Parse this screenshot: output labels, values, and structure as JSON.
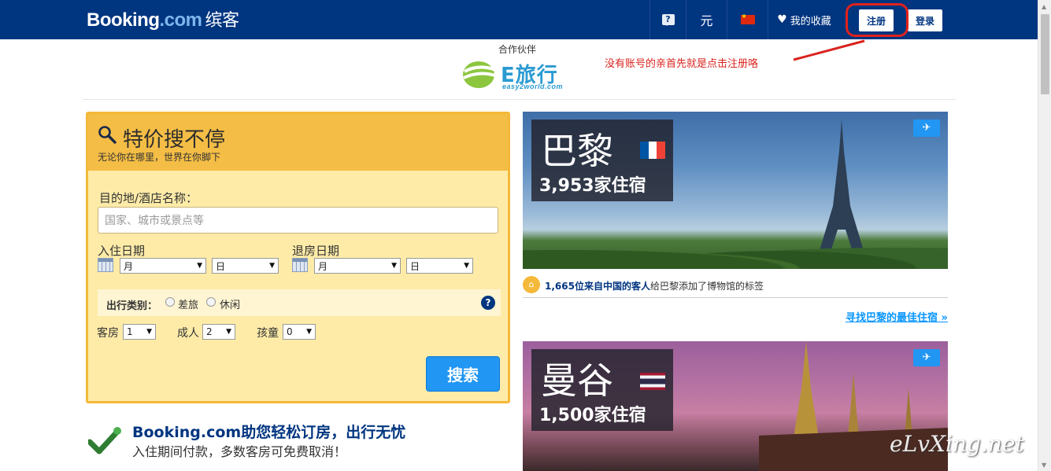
{
  "header": {
    "logo_main": "Booking",
    "logo_dotcom": ".com",
    "logo_cn": "缤客",
    "help_label": "?",
    "currency": "元",
    "favorites": "我的收藏",
    "register": "注册",
    "login": "登录"
  },
  "partner": {
    "label": "合作伙伴",
    "logo_text": "E旅行",
    "logo_sub": "easy2world.com"
  },
  "annotation": "没有账号的亲首先就是点击注册咯",
  "search": {
    "title": "特价搜不停",
    "subtitle": "无论你在哪里，世界在你脚下",
    "destination_label": "目的地/酒店名称：",
    "destination_placeholder": "国家、城市或景点等",
    "checkin_label": "入住日期",
    "checkout_label": "退房日期",
    "month_option": "月",
    "day_option": "日",
    "trip_type_label": "出行类别：",
    "trip_business": "差旅",
    "trip_leisure": "休闲",
    "help": "?",
    "rooms_label": "客房",
    "rooms_value": "1",
    "adults_label": "成人",
    "adults_value": "2",
    "children_label": "孩童",
    "children_value": "0",
    "button": "搜索"
  },
  "trust": {
    "title": "Booking.com助您轻松订房，出行无忧",
    "subtitle": "入住期间付款，多数客房可免费取消！"
  },
  "cards": {
    "paris": {
      "name": "巴黎",
      "count": "3,953家住宿",
      "info_bold": "1,665位来自中国的客人",
      "info_rest": "给巴黎添加了博物馆的标签",
      "link": "寻找巴黎的最佳住宿 »"
    },
    "bangkok": {
      "name": "曼谷",
      "count": "1,500家住宿"
    }
  },
  "watermark": "eLvXing.net",
  "colors": {
    "brand_blue": "#003580",
    "accent_blue": "#2196f3",
    "search_yellow": "#f4bd45",
    "annotation_red": "#d9231d"
  }
}
